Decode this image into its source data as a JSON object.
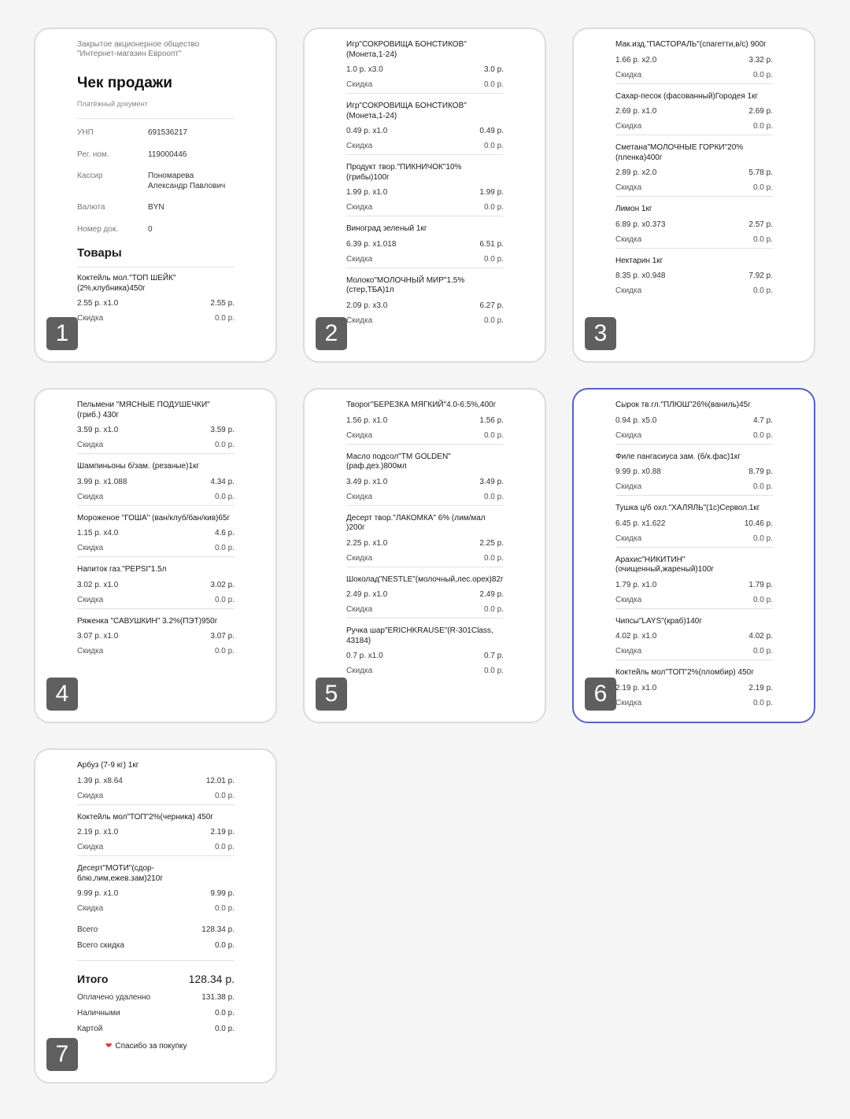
{
  "header": {
    "company": "Закрытое акционерное общество \"Интернет-магазин Евроопт\"",
    "title": "Чек продажи",
    "subtitle": "Платёжный документ",
    "fields": [
      {
        "label": "УНП",
        "value": "691536217"
      },
      {
        "label": "Рег. ном.",
        "value": "119000446"
      },
      {
        "label": "Кассир",
        "value": "Пономарева Александр Павлович"
      },
      {
        "label": "Валюта",
        "value": "BYN"
      },
      {
        "label": "Номер док.",
        "value": "0"
      }
    ],
    "goods_title": "Товары"
  },
  "discount_label": "Скидка",
  "pages": [
    {
      "number": "1",
      "items": [
        {
          "name": "Коктейль мол.\"ТОП ШЕЙК\"(2%,клубника)450г",
          "qty": "2.55 р. x1.0",
          "sum": "2.55 р.",
          "discount": "0.0 р."
        }
      ]
    },
    {
      "number": "2",
      "items": [
        {
          "name": "Игр\"СОКРОВИЩА БОНСТИКОВ\"(Монета,1-24)",
          "qty": "1.0 р. x3.0",
          "sum": "3.0 р.",
          "discount": "0.0 р."
        },
        {
          "name": "Игр\"СОКРОВИЩА БОНСТИКОВ\"(Монета,1-24)",
          "qty": "0.49 р. x1.0",
          "sum": "0.49 р.",
          "discount": "0.0 р."
        },
        {
          "name": "Продукт твор.\"ПИКНИЧОК\"10%(грибы)100г",
          "qty": "1.99 р. x1.0",
          "sum": "1.99 р.",
          "discount": "0.0 р."
        },
        {
          "name": "Виноград зеленый 1кг",
          "qty": "6.39 р. x1.018",
          "sum": "6.51 р.",
          "discount": "0.0 р."
        },
        {
          "name": "Молоко\"МОЛОЧНЫЙ МИР\"1.5%(стер,ТБА)1л",
          "qty": "2.09 р. x3.0",
          "sum": "6.27 р.",
          "discount": "0.0 р."
        }
      ]
    },
    {
      "number": "3",
      "items": [
        {
          "name": "Мак.изд.\"ПАСТОРАЛЬ\"(спагетти,в/с) 900г",
          "qty": "1.66 р. x2.0",
          "sum": "3.32 р.",
          "discount": "0.0 р."
        },
        {
          "name": "Сахар-песок (фасованный)Городея 1кг",
          "qty": "2.69 р. x1.0",
          "sum": "2.69 р.",
          "discount": "0.0 р."
        },
        {
          "name": "Сметана\"МОЛОЧНЫЕ ГОРКИ\"20%(пленка)400г",
          "qty": "2.89 р. x2.0",
          "sum": "5.78 р.",
          "discount": "0.0 р."
        },
        {
          "name": "Лимон 1кг",
          "qty": "6.89 р. x0.373",
          "sum": "2.57 р.",
          "discount": "0.0 р."
        },
        {
          "name": "Нектарин 1кг",
          "qty": "8.35 р. x0.948",
          "sum": "7.92 р.",
          "discount": "0.0 р."
        }
      ]
    },
    {
      "number": "4",
      "items": [
        {
          "name": "Пельмени \"МЯСНЫЕ ПОДУШЕЧКИ\" (гриб.) 430г",
          "qty": "3.59 р. x1.0",
          "sum": "3.59 р.",
          "discount": "0.0 р."
        },
        {
          "name": "Шампиньоны б/зам. (резаные)1кг",
          "qty": "3.99 р. x1.088",
          "sum": "4.34 р.",
          "discount": "0.0 р."
        },
        {
          "name": "Мороженое \"ГОША\" (ван/клуб/бан/кив)65г",
          "qty": "1.15 р. x4.0",
          "sum": "4.6 р.",
          "discount": "0.0 р."
        },
        {
          "name": "Напиток газ.\"PEPSI\"1.5л",
          "qty": "3.02 р. x1.0",
          "sum": "3.02 р.",
          "discount": "0.0 р."
        },
        {
          "name": "Ряженка \"САВУШКИН\" 3.2%(ПЭТ)950г",
          "qty": "3.07 р. x1.0",
          "sum": "3.07 р.",
          "discount": "0.0 р."
        }
      ]
    },
    {
      "number": "5",
      "items": [
        {
          "name": "Творог\"БЕРЕЗКА МЯГКИЙ\"4.0-6.5%,400г",
          "qty": "1.56 р. x1.0",
          "sum": "1.56 р.",
          "discount": "0.0 р."
        },
        {
          "name": "Масло подсол\"ТМ GOLDEN\"(раф.дез.)800мл",
          "qty": "3.49 р. x1.0",
          "sum": "3.49 р.",
          "discount": "0.0 р."
        },
        {
          "name": "Десерт твор.\"ЛАКОМКА\" 6% (лим/мал )200г",
          "qty": "2.25 р. x1.0",
          "sum": "2.25 р.",
          "discount": "0.0 р."
        },
        {
          "name": "Шоколад\"NESTLE\"(молочный,лес.орех)82г",
          "qty": "2.49 р. x1.0",
          "sum": "2.49 р.",
          "discount": "0.0 р."
        },
        {
          "name": "Ручка шар\"ERICHKRAUSE\"(R-301Class, 43184)",
          "qty": "0.7 р. x1.0",
          "sum": "0.7 р.",
          "discount": "0.0 р."
        }
      ]
    },
    {
      "number": "6",
      "items": [
        {
          "name": "Сырок тв.гл.\"ПЛЮШ\"26%(ваниль)45г",
          "qty": "0.94 р. x5.0",
          "sum": "4.7 р.",
          "discount": "0.0 р."
        },
        {
          "name": "Филе пангасиуса зам. (б/к.фас)1кг",
          "qty": "9.99 р. x0.88",
          "sum": "8.79 р.",
          "discount": "0.0 р."
        },
        {
          "name": "Тушка ц/б охл.\"ХАЛЯЛЬ\"(1с)Сервол.1кг",
          "qty": "6.45 р. x1.622",
          "sum": "10.46 р.",
          "discount": "0.0 р."
        },
        {
          "name": "Арахис\"НИКИТИН\"(очищенный,жареный)100г",
          "qty": "1.79 р. x1.0",
          "sum": "1.79 р.",
          "discount": "0.0 р."
        },
        {
          "name": "Чипсы\"LAYS\"(краб)140г",
          "qty": "4.02 р. x1.0",
          "sum": "4.02 р.",
          "discount": "0.0 р."
        },
        {
          "name": "Коктейль мол\"ТОП\"2%(пломбир) 450г",
          "qty": "2.19 р. x1.0",
          "sum": "2.19 р.",
          "discount": "0.0 р."
        }
      ]
    },
    {
      "number": "7",
      "items": [
        {
          "name": "Арбуз (7-9 кг) 1кг",
          "qty": "1.39 р. x8.64",
          "sum": "12.01 р.",
          "discount": "0.0 р."
        },
        {
          "name": "Коктейль мол\"ТОП\"2%(черника) 450г",
          "qty": "2.19 р. x1.0",
          "sum": "2.19 р.",
          "discount": "0.0 р."
        },
        {
          "name": "Десерт\"МОТИ\"(сдор-блю,лим,ежев.зам)210г",
          "qty": "9.99 р. x1.0",
          "sum": "9.99 р.",
          "discount": "0.0 р."
        }
      ]
    }
  ],
  "totals": {
    "total_label": "Всего",
    "total_value": "128.34 р.",
    "discount_total_label": "Всего скидка",
    "discount_total_value": "0.0 р.",
    "grand_label": "Итого",
    "grand_value": "128.34 р.",
    "paid_remote_label": "Оплачено удаленно",
    "paid_remote_value": "131.38 р.",
    "cash_label": "Наличными",
    "cash_value": "0.0 р.",
    "card_label": "Картой",
    "card_value": "0.0 р.",
    "thanks": "Спасибо за покупку"
  },
  "colors": {
    "selected_border": "#5563c1",
    "badge": "#5f5f5f",
    "heart": "#e53935"
  }
}
